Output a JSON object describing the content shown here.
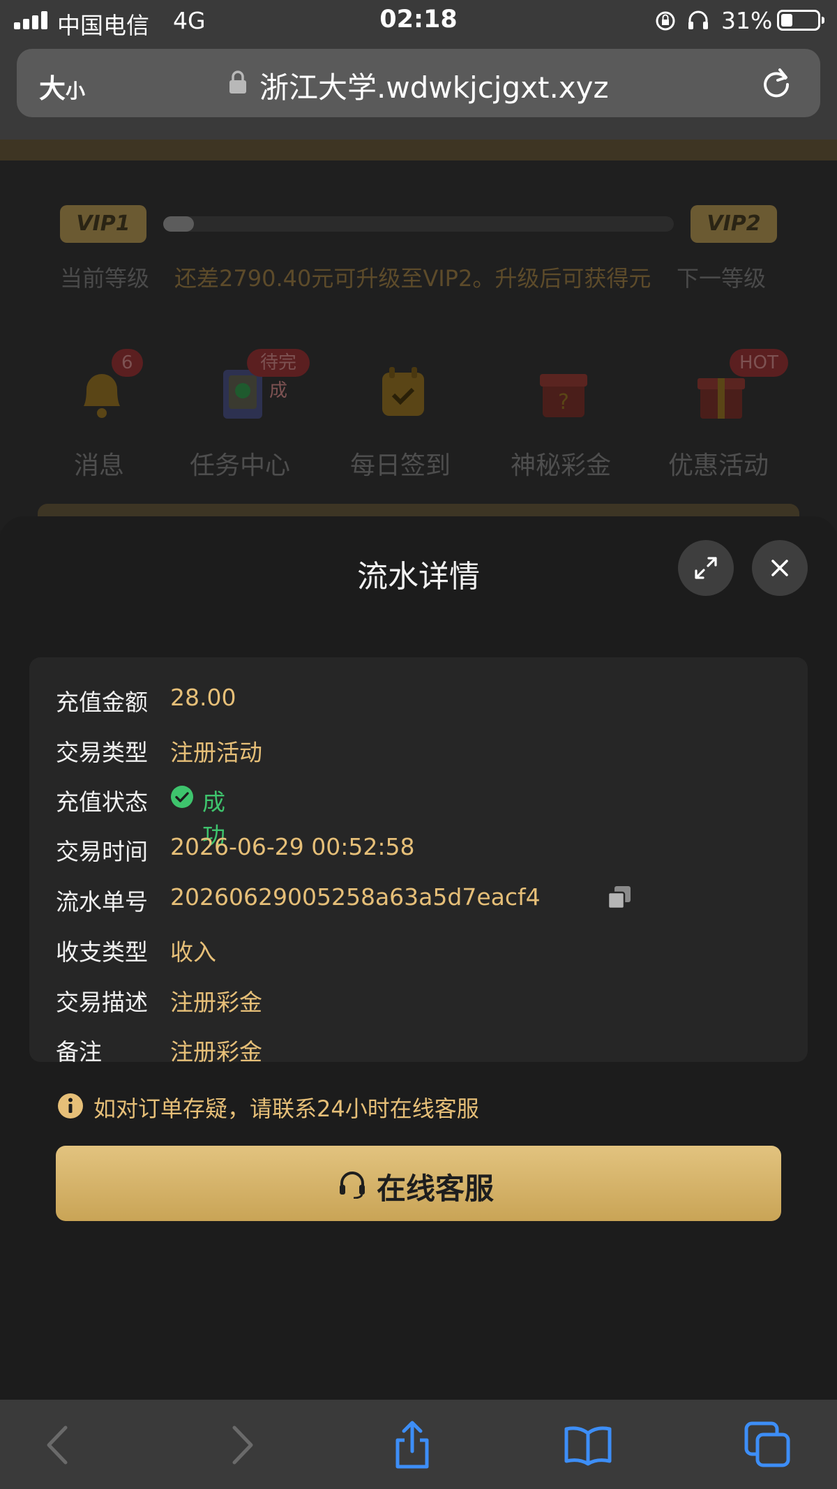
{
  "status_bar": {
    "carrier": "中国电信",
    "network": "4G",
    "time": "02:18",
    "battery_percent": "31%",
    "battery_level": 0.31
  },
  "browser": {
    "text_size_big": "大",
    "text_size_small": "小",
    "url": "浙江大学.wdwkjcjgxt.xyz"
  },
  "background_page": {
    "vip_current_badge": "VIP1",
    "vip_next_badge": "VIP2",
    "vip_progress": 0.06,
    "current_level_label": "当前等级",
    "upgrade_hint": "还差2790.40元可升级至VIP2。升级后可获得元",
    "next_level_label": "下一等级",
    "icons": [
      {
        "label": "消息",
        "badge": "6",
        "icon": "bell-icon"
      },
      {
        "label": "任务中心",
        "badge": "待完成",
        "icon": "task-icon"
      },
      {
        "label": "每日签到",
        "badge": "",
        "icon": "calendar-icon"
      },
      {
        "label": "神秘彩金",
        "badge": "",
        "icon": "mystery-box-icon"
      },
      {
        "label": "优惠活动",
        "badge": "HOT",
        "icon": "gift-icon"
      }
    ]
  },
  "sheet": {
    "title": "流水详情",
    "details": [
      {
        "label": "充值金额",
        "value": "28.00"
      },
      {
        "label": "交易类型",
        "value": "注册活动"
      },
      {
        "label": "充值状态",
        "value": "成功"
      },
      {
        "label": "交易时间",
        "value": "2026-06-29 00:52:58"
      },
      {
        "label": "流水单号",
        "value": "20260629005258a63a5d7eacf4"
      },
      {
        "label": "收支类型",
        "value": "收入"
      },
      {
        "label": "交易描述",
        "value": "注册彩金"
      },
      {
        "label": "备注",
        "value": "注册彩金"
      }
    ],
    "notice": "如对订单存疑，请联系24小时在线客服",
    "service_button": "在线客服"
  },
  "colors": {
    "gold": "#e6bf78",
    "success": "#3ec46d",
    "button_gold": "#d6b46a",
    "ios_blue": "#3d8ef7"
  }
}
